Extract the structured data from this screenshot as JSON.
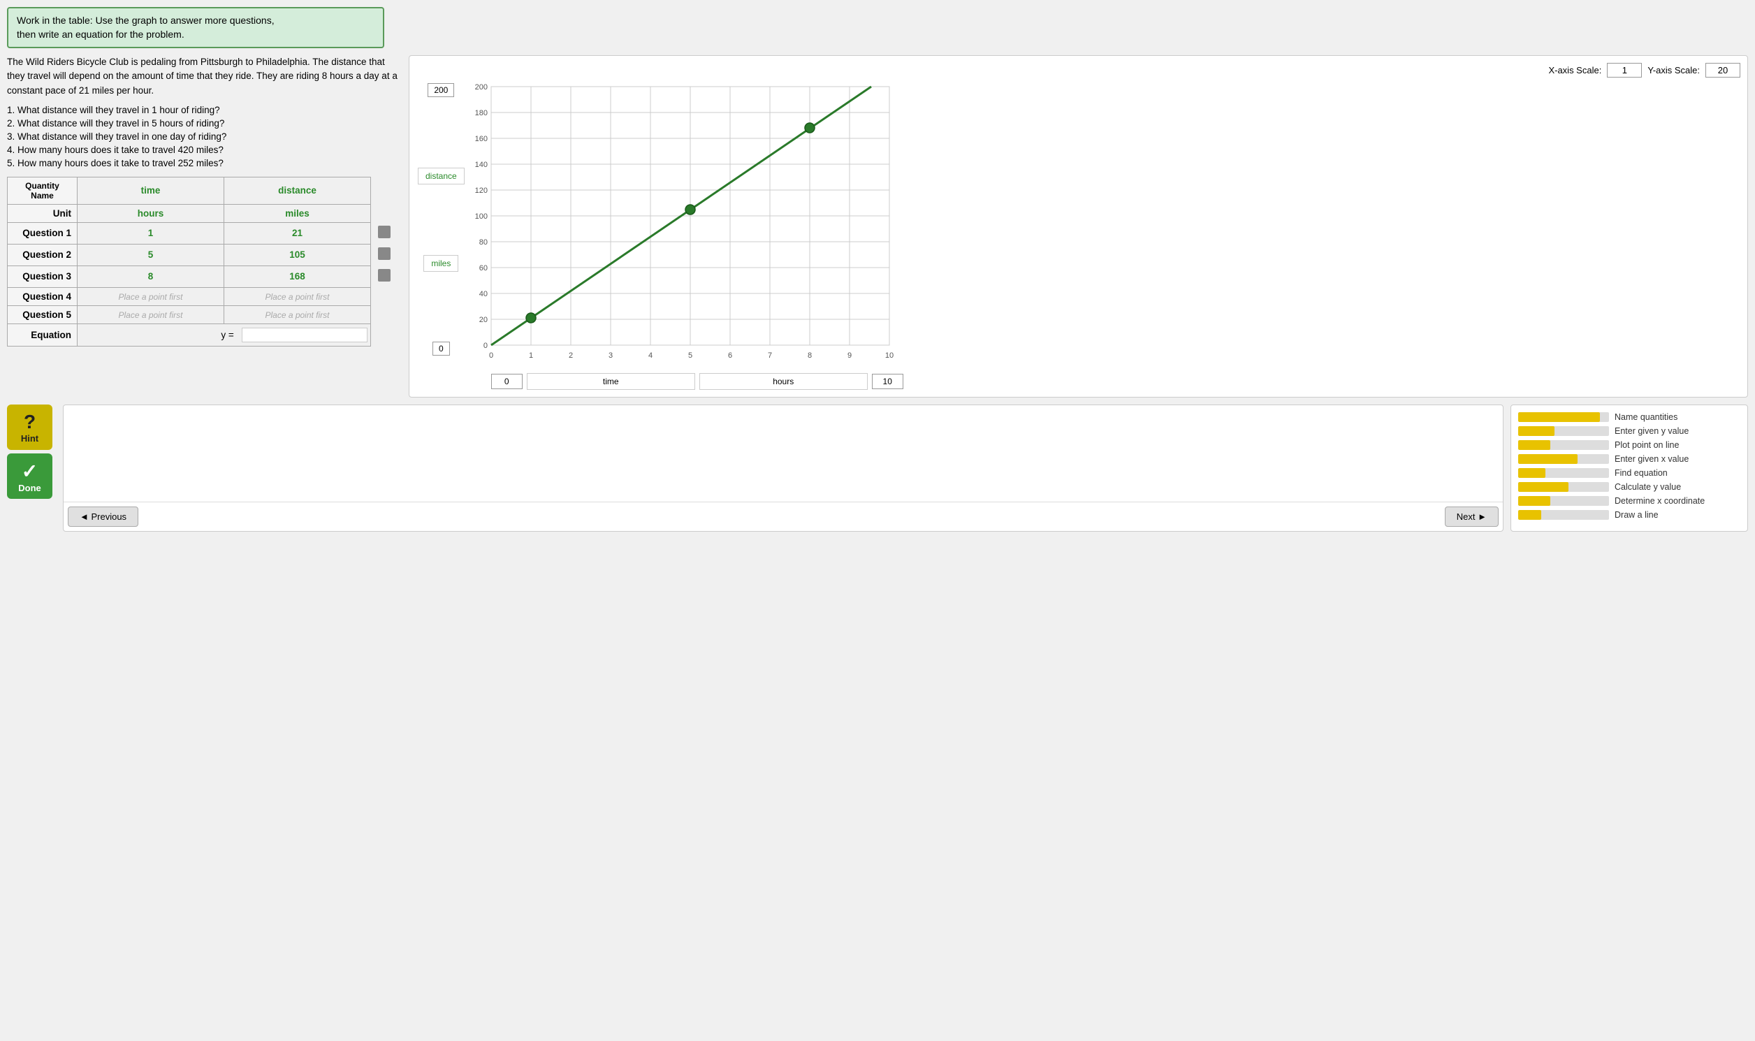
{
  "instruction": {
    "text": "Work in the table: Use the graph to answer more questions,\nthen write an equation for the problem."
  },
  "problem": {
    "text": "The Wild Riders Bicycle Club is pedaling from Pittsburgh to Philadelphia. The distance that they travel will depend on the amount of time that they ride. They are riding 8 hours a day at a constant pace of 21 miles per hour."
  },
  "questions": [
    "1. What distance will they travel in 1 hour of riding?",
    "2. What distance will they travel in 5 hours of riding?",
    "3. What distance will they travel in one day of riding?",
    "4. How many hours does it take to travel 420 miles?",
    "5. How many hours does it take to travel 252 miles?"
  ],
  "table": {
    "col1_header": "time",
    "col2_header": "distance",
    "qty_name": "Quantity\nName",
    "unit_label": "Unit",
    "col1_unit": "hours",
    "col2_unit": "miles",
    "rows": [
      {
        "label": "Question 1",
        "col1": "1",
        "col2": "21",
        "has_icon": true
      },
      {
        "label": "Question 2",
        "col1": "5",
        "col2": "105",
        "has_icon": true
      },
      {
        "label": "Question 3",
        "col1": "8",
        "col2": "168",
        "has_icon": true
      },
      {
        "label": "Question 4",
        "col1": "Place a point first",
        "col2": "Place a point first",
        "has_icon": false
      },
      {
        "label": "Question 5",
        "col1": "Place a point first",
        "col2": "Place a point first",
        "has_icon": false
      }
    ],
    "equation_label": "Equation",
    "equation_prefix": "y =",
    "equation_value": ""
  },
  "graph": {
    "x_axis_scale_label": "X-axis Scale:",
    "x_axis_scale_value": "1",
    "y_axis_scale_label": "Y-axis Scale:",
    "y_axis_scale_value": "20",
    "y_top_label": "200",
    "y_axis_label": "distance",
    "y_axis_sublabel": "miles",
    "y_bottom_label": "0",
    "x_axis_start": "0",
    "x_axis_label": "time",
    "x_axis_unit": "hours",
    "x_axis_end": "10",
    "points": [
      {
        "x": 1,
        "y": 21
      },
      {
        "x": 5,
        "y": 105
      },
      {
        "x": 8,
        "y": 168
      }
    ],
    "x_ticks": [
      "0",
      "1",
      "2",
      "3",
      "4",
      "5",
      "6",
      "7",
      "8",
      "9",
      "10"
    ],
    "y_ticks": [
      "0",
      "20",
      "40",
      "60",
      "80",
      "100",
      "120",
      "140",
      "160",
      "180",
      "200"
    ]
  },
  "hint": {
    "symbol": "?",
    "label": "Hint"
  },
  "done": {
    "symbol": "✓",
    "label": "Done"
  },
  "nav": {
    "previous": "◄ Previous",
    "next": "Next ►"
  },
  "progress": [
    {
      "label": "Name quantities",
      "pct": 90
    },
    {
      "label": "Enter given y value",
      "pct": 40
    },
    {
      "label": "Plot point on line",
      "pct": 35
    },
    {
      "label": "Enter given x value",
      "pct": 65
    },
    {
      "label": "Find equation",
      "pct": 30
    },
    {
      "label": "Calculate y value",
      "pct": 55
    },
    {
      "label": "Determine x coordinate",
      "pct": 35
    },
    {
      "label": "Draw a line",
      "pct": 25
    }
  ]
}
